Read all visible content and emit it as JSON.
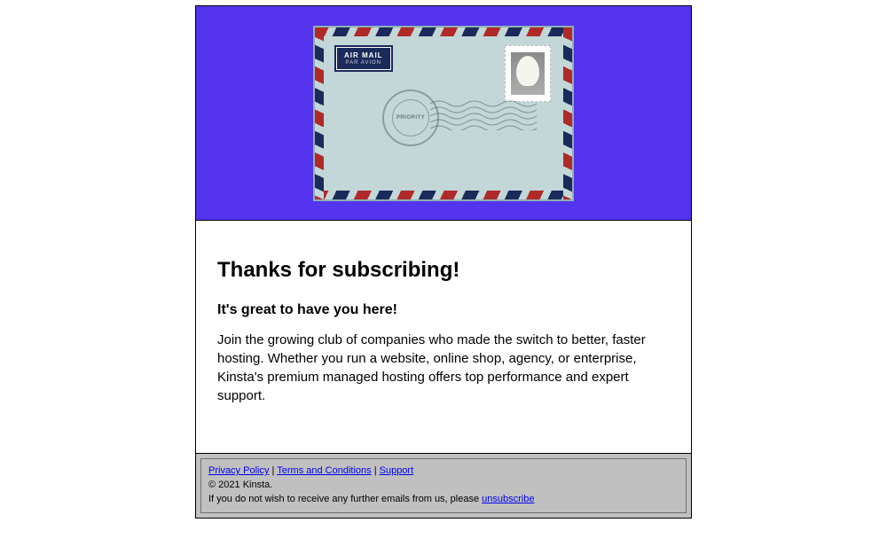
{
  "hero": {
    "airmail_line1": "AIR MAIL",
    "airmail_line2": "PAR AVION",
    "postmark_label": "PRIORITY"
  },
  "body": {
    "heading": "Thanks for subscribing!",
    "subheading": "It's great to have you here!",
    "paragraph": "Join the growing club of companies who made the switch to better, faster hosting. Whether you run a website, online shop, agency, or enterprise, Kinsta's premium managed hosting offers top performance and expert support."
  },
  "footer": {
    "links": {
      "privacy": "Privacy Policy",
      "terms": "Terms and Conditions",
      "support": "Support"
    },
    "separator": " | ",
    "copyright": "© 2021 Kinsta.",
    "unsubscribe_prefix": "If you do not wish to receive any further emails from us, please ",
    "unsubscribe_link": "unsubscribe"
  }
}
